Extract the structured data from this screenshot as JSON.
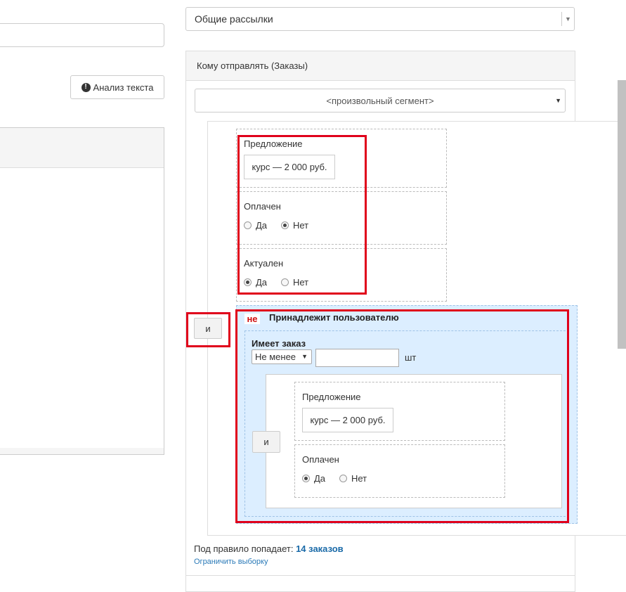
{
  "left": {
    "analysis_button": "Анализ текста"
  },
  "mailing_type": {
    "selected": "Общие рассылки"
  },
  "recipients": {
    "header": "Кому отправлять (Заказы)",
    "segment_selected": "<произвольный сегмент>",
    "conditions": [
      {
        "label": "Предложение",
        "value": "курс — 2 000 руб."
      },
      {
        "label": "Оплачен",
        "options": [
          "Да",
          "Нет"
        ],
        "selected": "Нет"
      },
      {
        "label": "Актуален",
        "options": [
          "Да",
          "Нет"
        ],
        "selected": "Да"
      }
    ],
    "and_button": "и",
    "negation": {
      "badge": "не",
      "title": "Принадлежит пользователю",
      "has_order_label": "Имеет заказ",
      "quantity_operator": "Не менее",
      "quantity_value": "",
      "quantity_unit": "шт",
      "and_button": "и",
      "conditions": [
        {
          "label": "Предложение",
          "value": "курс — 2 000 руб."
        },
        {
          "label": "Оплачен",
          "options": [
            "Да",
            "Нет"
          ],
          "selected": "Да"
        }
      ]
    },
    "result_prefix": "Под правило попадает:",
    "result_count": "14 заказов",
    "limit_link": "Ограничить выборку"
  },
  "colors": {
    "highlight": "#e0001b",
    "negation_bg": "#dceeff",
    "link": "#1a6aa8"
  }
}
